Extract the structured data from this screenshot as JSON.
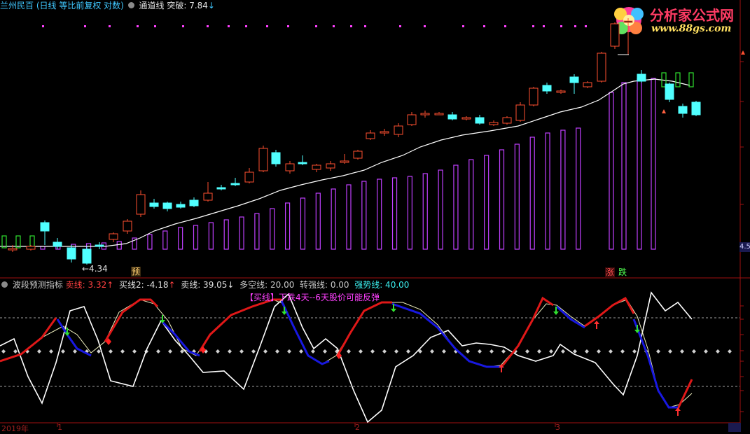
{
  "main_header": {
    "stock_name": "兰州民百",
    "chart_mode": "(日线 等比前复权 对数)",
    "indicator_name": "通道线",
    "breakout_label": "突破: 7.84",
    "breakout_arrow": "↓"
  },
  "logo": {
    "title": "分析家公式网",
    "url": "www.88gs.com"
  },
  "price_labels": {
    "low_marker": "←4.34",
    "tag_yu": "预",
    "tag_zhang": "涨",
    "tag_die": "跌",
    "right_axis_value": "4.5"
  },
  "indicator_header": {
    "name": "波段预测指标",
    "sell_line": "卖线: 3.32",
    "sell_arrow": "↑",
    "buy_line2": "买线2: -4.18",
    "buy_line2_arrow": "↑",
    "sell_line_b": "卖线: 39.05",
    "sell_line_b_arrow": "↓",
    "long_short": "多空线: 20.00",
    "turn_strong": "转强线: 0.00",
    "strong_line": "强势线: 40.00"
  },
  "signal_text": {
    "bracket": "【买线】",
    "body": "下跌4天--6天股价可能反弹"
  },
  "date_axis": [
    "2019年",
    "1",
    "2",
    "3"
  ],
  "colors": {
    "up_candle": "#ff5030",
    "down_candle": "#50ffff",
    "channel_bar": "#c040ff",
    "red_line": "#e01818",
    "blue_line": "#1818e0",
    "white_line": "#ffffff",
    "thin_line": "#f0f0c0"
  },
  "icons": [
    "settings-circle-icon",
    "buy-arrow-icon",
    "sell-arrow-icon"
  ]
}
